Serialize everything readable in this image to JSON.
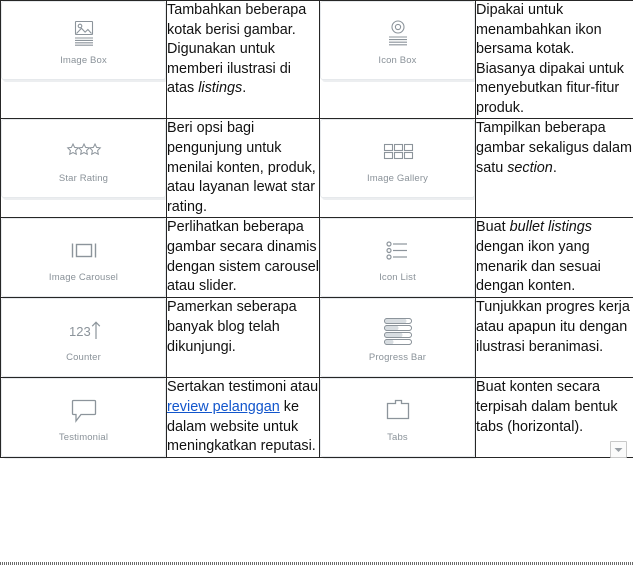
{
  "table": {
    "rows": [
      {
        "left_card": {
          "label": "Image Box",
          "icon": "image-box-icon"
        },
        "left_desc_html": "Tambahkan beberapa kotak berisi gambar. Digunakan untuk memberi ilustrasi di atas <i>listings</i>.",
        "right_card": {
          "label": "Icon Box",
          "icon": "icon-box-icon"
        },
        "right_desc_html": "Dipakai untuk menambahkan ikon bersama kotak. Biasanya dipakai untuk menyebutkan fitur-fitur produk."
      },
      {
        "left_card": {
          "label": "Star Rating",
          "icon": "star-rating-icon"
        },
        "left_desc_html": "Beri opsi bagi pengunjung untuk menilai konten, produk, atau layanan lewat star rating.",
        "right_card": {
          "label": "Image Gallery",
          "icon": "image-gallery-icon"
        },
        "right_desc_html": "Tampilkan beberapa gambar sekaligus dalam satu <i>section</i>."
      },
      {
        "left_card": {
          "label": "Image Carousel",
          "icon": "image-carousel-icon"
        },
        "left_desc_html": "Perlihatkan beberapa gambar secara dinamis dengan sistem carousel atau slider.",
        "right_card": {
          "label": "Icon List",
          "icon": "icon-list-icon"
        },
        "right_desc_html": "Buat <i>bullet listings</i> dengan ikon yang menarik dan sesuai dengan konten."
      },
      {
        "left_card": {
          "label": "Counter",
          "icon": "counter-icon"
        },
        "left_desc_html": "Pamerkan seberapa banyak blog telah dikunjungi.",
        "right_card": {
          "label": "Progress Bar",
          "icon": "progress-bar-icon"
        },
        "right_desc_html": "Tunjukkan progres kerja atau apapun itu dengan ilustrasi beranimasi."
      },
      {
        "left_card": {
          "label": "Testimonial",
          "icon": "testimonial-icon"
        },
        "left_desc_html": "Sertakan testimoni atau <a href=\"#\">review pelanggan</a> ke dalam website untuk meningkatkan reputasi.",
        "right_card": {
          "label": "Tabs",
          "icon": "tabs-icon"
        },
        "right_desc_html": "Buat konten secara terpisah dalam bentuk tabs (horizontal)."
      }
    ]
  },
  "overlay": {
    "dropdown_button": {
      "icon": "chevron-down-icon"
    }
  },
  "colors": {
    "border": "#262626",
    "card_border": "#e6e9ec",
    "card_shadow": "#eceef0",
    "label_text": "#8a9299",
    "body_text": "#111111",
    "link": "#1155cc",
    "icon_stroke": "#8c949b"
  },
  "counter_icon_text": "123"
}
